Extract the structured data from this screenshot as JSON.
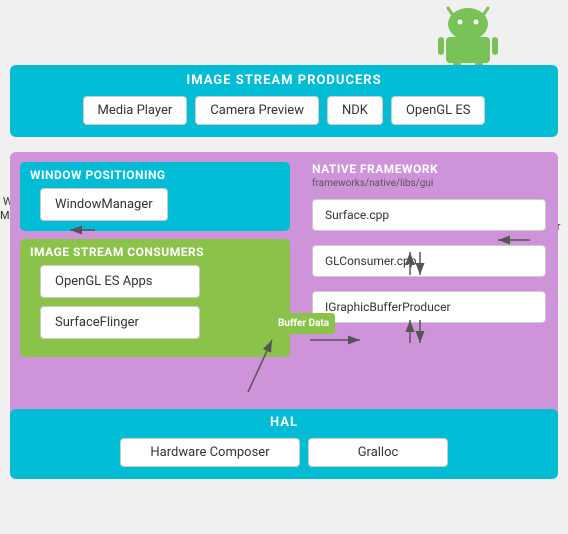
{
  "android_robot": {
    "aria": "Android robot logo"
  },
  "isp": {
    "title": "IMAGE STREAM PRODUCERS",
    "items": [
      {
        "label": "Media Player"
      },
      {
        "label": "Camera Preview"
      },
      {
        "label": "NDK"
      },
      {
        "label": "OpenGL ES"
      }
    ]
  },
  "window_positioning": {
    "title": "WINDOW POSITIONING",
    "manager_label": "WindowManager"
  },
  "window_metadata": {
    "label": "Window\nMetadata"
  },
  "buffer_data_left": {
    "label": "Buffer\nData"
  },
  "buffer_data_right": {
    "label": "Buffer\nData"
  },
  "isc": {
    "title": "IMAGE STREAM CONSUMERS",
    "items": [
      {
        "label": "OpenGL ES Apps"
      },
      {
        "label": "SurfaceFlinger"
      }
    ]
  },
  "native_framework": {
    "title": "NATIVE FRAMEWORK",
    "subtitle": "frameworks/native/libs/gui",
    "items": [
      {
        "label": "Surface.cpp"
      },
      {
        "label": "GLConsumer.cpp"
      },
      {
        "label": "IGraphicBufferProducer"
      }
    ]
  },
  "hal": {
    "title": "HAL",
    "items": [
      {
        "label": "Hardware Composer"
      },
      {
        "label": "Gralloc"
      }
    ]
  }
}
